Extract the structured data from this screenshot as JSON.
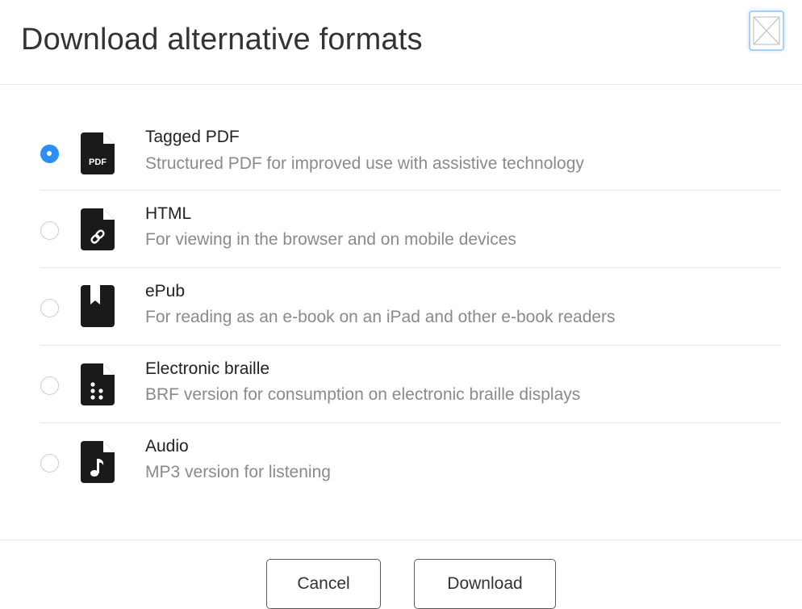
{
  "dialog": {
    "title": "Download alternative formats",
    "close_icon": "close-x-icon"
  },
  "formats": [
    {
      "label": "Tagged PDF",
      "description": "Structured PDF for improved use with assistive technology",
      "icon": "pdf-file-icon",
      "icon_text": "PDF",
      "selected": true
    },
    {
      "label": "HTML",
      "description": "For viewing in the browser and on mobile devices",
      "icon": "link-file-icon",
      "selected": false
    },
    {
      "label": "ePub",
      "description": "For reading as an e-book on an iPad and other e-book readers",
      "icon": "book-icon",
      "selected": false
    },
    {
      "label": "Electronic braille",
      "description": "BRF version for consumption on electronic braille displays",
      "icon": "braille-file-icon",
      "selected": false
    },
    {
      "label": "Audio",
      "description": "MP3 version for listening",
      "icon": "audio-file-icon",
      "selected": false
    }
  ],
  "footer": {
    "cancel_label": "Cancel",
    "download_label": "Download"
  },
  "colors": {
    "accent": "#2f8ef5",
    "icon": "#1a1a1a",
    "description": "#8a8a8a"
  }
}
